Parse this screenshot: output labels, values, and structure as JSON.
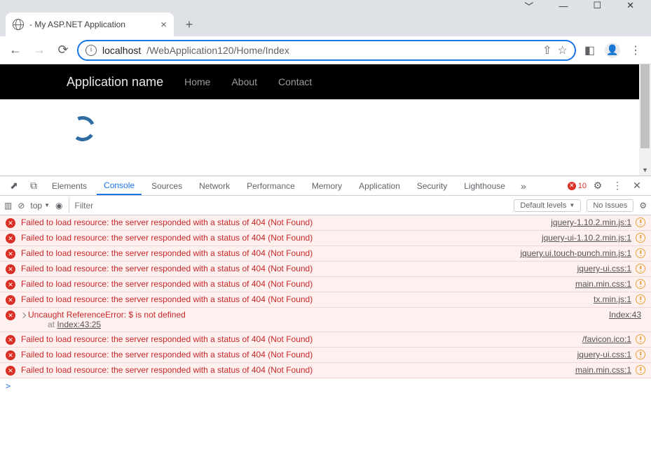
{
  "window": {
    "tab_title": " - My ASP.NET Application"
  },
  "toolbar": {
    "url_host": "localhost",
    "url_path": "/WebApplication120/Home/Index"
  },
  "page": {
    "brand": "Application name",
    "nav": [
      "Home",
      "About",
      "Contact"
    ]
  },
  "devtools": {
    "tabs": [
      "Elements",
      "Console",
      "Sources",
      "Network",
      "Performance",
      "Memory",
      "Application",
      "Security",
      "Lighthouse"
    ],
    "active_tab": "Console",
    "error_count": "10",
    "context": "top",
    "filter_placeholder": "Filter",
    "levels_label": "Default levels",
    "no_issues": "No Issues"
  },
  "console": {
    "fail_msg": "Failed to load resource: the server responded with a status of 404 (Not Found)",
    "uncaught": {
      "msg": "Uncaught ReferenceError: $ is not defined",
      "at": "at ",
      "loc": "Index:43:25",
      "src": "Index:43"
    },
    "rows": [
      {
        "src": "jquery-1.10.2.min.js:1"
      },
      {
        "src": "jquery-ui-1.10.2.min.js:1"
      },
      {
        "src": "jquery.ui.touch-punch.min.js:1"
      },
      {
        "src": "jquery-ui.css:1"
      },
      {
        "src": "main.min.css:1"
      },
      {
        "src": "tx.min.js:1"
      }
    ],
    "rows2": [
      {
        "src": "/favicon.ico:1"
      },
      {
        "src": "jquery-ui.css:1"
      },
      {
        "src": "main.min.css:1"
      }
    ],
    "prompt": ">"
  }
}
